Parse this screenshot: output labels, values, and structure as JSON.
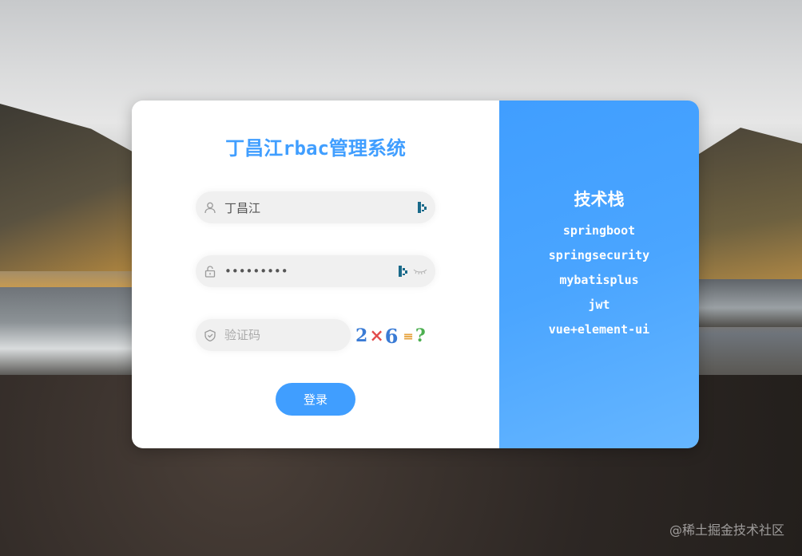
{
  "app": {
    "title": "丁昌江rbac管理系统"
  },
  "login_form": {
    "username_value": "丁昌江",
    "username_placeholder": "",
    "password_value": "•••••••••",
    "captcha_value": "",
    "captcha_placeholder": "验证码",
    "captcha_text": "2×6≡?",
    "login_label": "登录"
  },
  "tech_stack": {
    "title": "技术栈",
    "items": [
      "springboot",
      "springsecurity",
      "mybatisplus",
      "jwt",
      "vue+element-ui"
    ]
  },
  "watermark": "@稀土掘金技术社区",
  "colors": {
    "accent": "#409eff",
    "card_bg": "#ffffff",
    "input_bg": "#f0f0f0",
    "panel_text": "#ffffff"
  },
  "icons": {
    "username_prefix": "user-icon",
    "password_prefix": "lock-icon",
    "captcha_prefix": "shield-icon",
    "password_toggle": "eye-closed-icon",
    "autofill": "password-manager-icon"
  }
}
